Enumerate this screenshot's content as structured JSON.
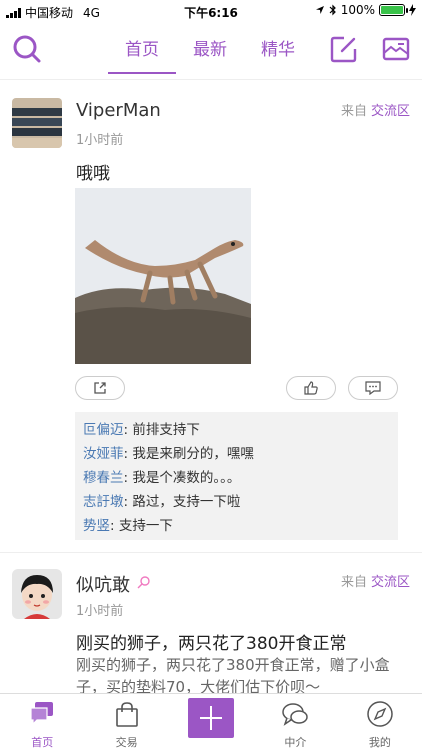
{
  "status_bar": {
    "carrier": "中国移动",
    "network": "4G",
    "time": "下午6:16",
    "battery": "100%"
  },
  "top_nav": {
    "tabs": [
      {
        "label": "首页",
        "active": true
      },
      {
        "label": "最新",
        "active": false
      },
      {
        "label": "精华",
        "active": false
      }
    ]
  },
  "posts": [
    {
      "username": "ViperMan",
      "time": "1小时前",
      "source_prefix": "来自",
      "source_zone": "交流区",
      "title": "哦哦",
      "comments": [
        {
          "name": "叵偏迈",
          "text": "前排支持下"
        },
        {
          "name": "汝娅菲",
          "text": "我是来刷分的，嘿嘿"
        },
        {
          "name": "穆春兰",
          "text": "我是个凑数的。。。"
        },
        {
          "name": "志訏墩",
          "text": "路过，支持一下啦"
        },
        {
          "name": "势竖",
          "text": "支持一下"
        }
      ]
    },
    {
      "username": "似吭敢",
      "time": "1小时前",
      "source_prefix": "来自",
      "source_zone": "交流区",
      "title": "刚买的狮子，两只花了380开食正常",
      "preview": "刚买的狮子，两只花了380开食正常，赠了小盒子，买的垫料70，大佬们估下价呗～"
    }
  ],
  "bottom_bar": {
    "tabs": [
      {
        "label": "首页",
        "active": true
      },
      {
        "label": "交易",
        "active": false
      },
      {
        "label": "",
        "active": false
      },
      {
        "label": "中介",
        "active": false
      },
      {
        "label": "我的",
        "active": false
      }
    ]
  },
  "colors": {
    "accent": "#9b56c5",
    "link": "#4a79b3",
    "battery": "#3ac34a"
  }
}
